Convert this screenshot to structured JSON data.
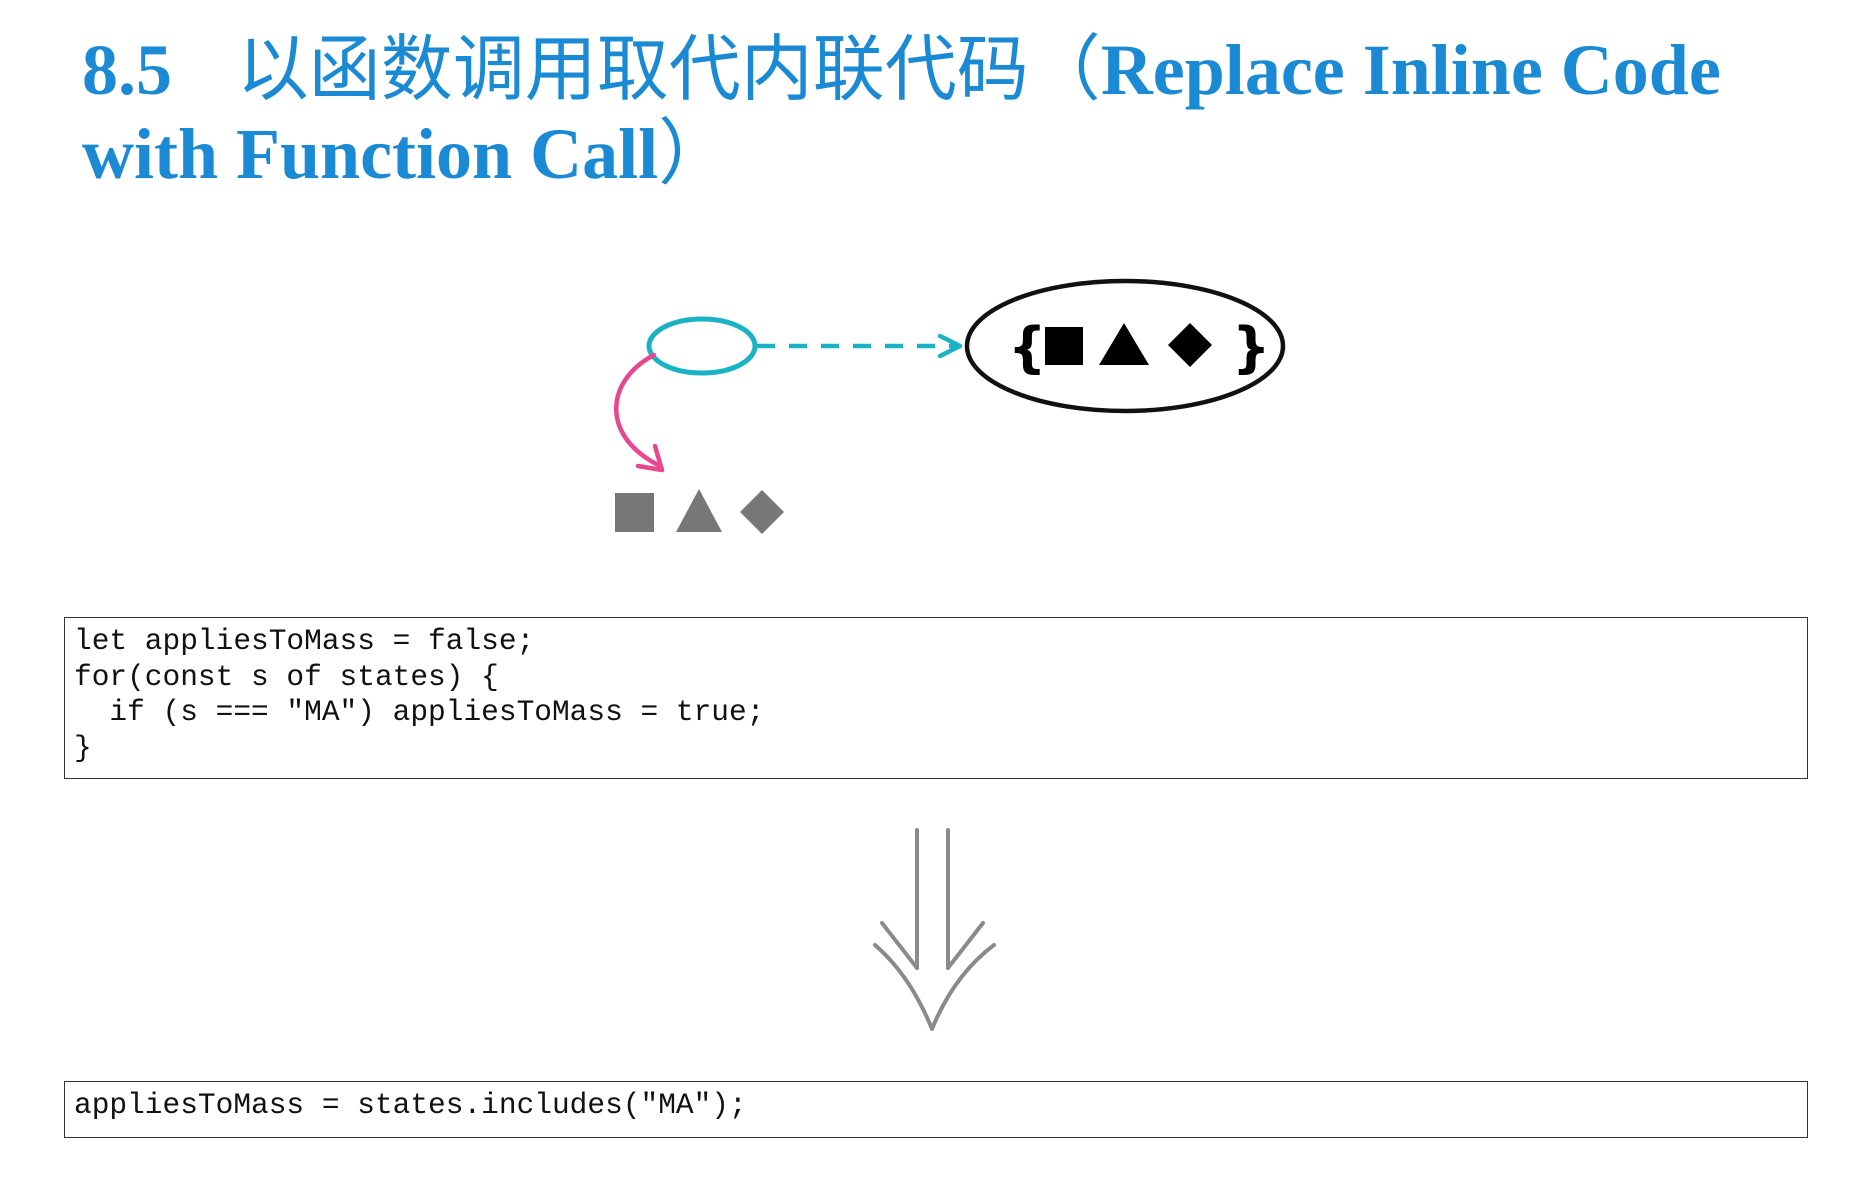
{
  "heading": {
    "number": "8.5",
    "title_zh": "以函数调用取代内联代码（",
    "title_en": "Replace Inline Code with Function Call",
    "close_paren": "）"
  },
  "figure": {
    "function_body_text": "{ ■ ▲ ◆ }",
    "inlined_shapes_text": "■ ▲ ◆",
    "colors": {
      "call_oval": "#1ab3c6",
      "dashed_arrow": "#1ab3c6",
      "curved_arrow": "#e8468e",
      "body_shapes": "#000000",
      "inlined_shapes": "#777777",
      "transform_arrow": "#8a8a8a"
    }
  },
  "code_before": "let appliesToMass = false;\nfor(const s of states) {\n  if (s === \"MA\") appliesToMass = true;\n}",
  "code_after": "appliesToMass = states.includes(\"MA\");",
  "colors": {
    "heading": "#1a8ad4"
  }
}
